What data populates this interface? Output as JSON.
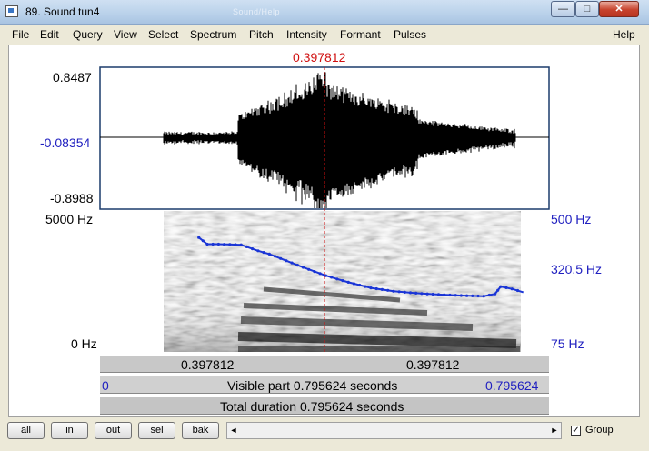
{
  "window": {
    "title": "89. Sound tun4",
    "ghost_title": "Sound/Help",
    "minimize_glyph": "—",
    "maximize_glyph": "□",
    "close_glyph": "✕"
  },
  "menu": {
    "items": [
      "File",
      "Edit",
      "Query",
      "View",
      "Select",
      "Spectrum",
      "Pitch",
      "Intensity",
      "Formant",
      "Pulses"
    ],
    "help": "Help"
  },
  "waveform": {
    "cursor_time": "0.397812",
    "y_max": "0.8487",
    "y_zero": "-0.08354",
    "y_min": "-0.8988"
  },
  "spectrogram": {
    "freq_max": "5000 Hz",
    "freq_min": "0 Hz",
    "pitch_max": "500 Hz",
    "pitch_mid": "320.5 Hz",
    "pitch_min": "75 Hz"
  },
  "chart_data": {
    "type": "line",
    "series": [
      {
        "name": "pitch contour",
        "x": [
          0.175,
          0.19,
          0.21,
          0.25,
          0.28,
          0.3,
          0.33,
          0.36,
          0.4,
          0.44,
          0.48,
          0.52,
          0.56,
          0.6,
          0.64,
          0.68,
          0.7,
          0.71,
          0.73,
          0.75
        ],
        "y": [
          420,
          400,
          400,
          398,
          380,
          370,
          350,
          330,
          305,
          285,
          268,
          258,
          252,
          248,
          245,
          243,
          250,
          272,
          265,
          255
        ]
      }
    ],
    "x_range": [
      0,
      0.795624
    ],
    "y_range": [
      75,
      500
    ],
    "cursor_x": 0.397812
  },
  "time_bar": {
    "left_segment": "0.397812",
    "right_segment": "0.397812"
  },
  "visible_bar": {
    "start": "0",
    "text": "Visible part 0.795624 seconds",
    "end": "0.795624"
  },
  "total_bar": {
    "text": "Total duration 0.795624 seconds"
  },
  "buttons": {
    "all": "all",
    "in": "in",
    "out": "out",
    "sel": "sel",
    "bak": "bak"
  },
  "scroll": {
    "left_arrow": "◄",
    "right_arrow": "►"
  },
  "group": {
    "label": "Group",
    "checked": "✓"
  },
  "colors": {
    "cursor": "#d01010",
    "pitch": "#1a35d6",
    "axis_label": "#2020c0"
  }
}
